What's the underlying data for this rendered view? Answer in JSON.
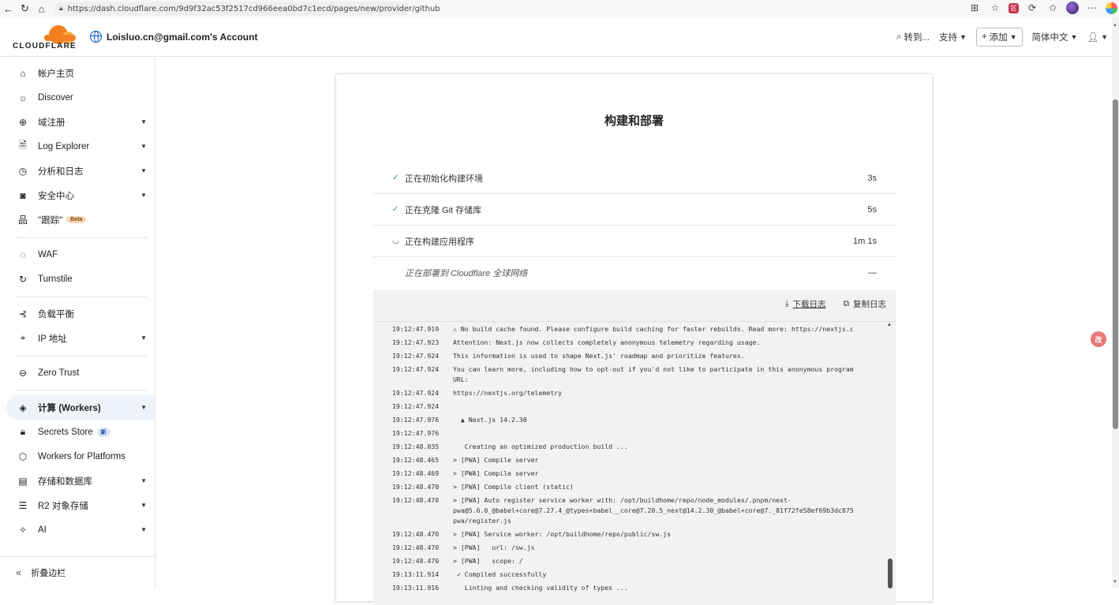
{
  "browser": {
    "url": "https://dash.cloudflare.com/9d9f32ac53f2517cd966eea0bd7c1ecd/pages/new/provider/github"
  },
  "header": {
    "logo_text": "CLOUDFLARE",
    "account": "Loisluo.cn@gmail.com's Account",
    "goto": "转到...",
    "support": "支持",
    "add": "添加",
    "language": "简体中文"
  },
  "sidebar": {
    "items": [
      {
        "label": "帐户主页",
        "icon": "home-icon"
      },
      {
        "label": "Discover",
        "icon": "lightbulb-icon"
      },
      {
        "label": "域注册",
        "icon": "globe-icon"
      },
      {
        "label": "Log Explorer",
        "icon": "file-search-icon"
      },
      {
        "label": "分析和日志",
        "icon": "clock-icon"
      },
      {
        "label": "安全中心",
        "icon": "shield-box-icon"
      },
      {
        "label": "\"跟踪\"",
        "icon": "network-icon",
        "badge": "Beta"
      },
      {
        "label": "WAF",
        "icon": "waf-icon"
      },
      {
        "label": "Turnstile",
        "icon": "turnstile-icon"
      },
      {
        "label": "负载平衡",
        "icon": "load-balance-icon"
      },
      {
        "label": "IP 地址",
        "icon": "pin-icon"
      },
      {
        "label": "Zero Trust",
        "icon": "zero-trust-icon"
      },
      {
        "label": "计算 (Workers)",
        "icon": "workers-icon"
      },
      {
        "label": "Secrets Store",
        "icon": "lock-icon",
        "badge": "新"
      },
      {
        "label": "Workers for Platforms",
        "icon": "box-icon"
      },
      {
        "label": "存储和数据库",
        "icon": "database-icon"
      },
      {
        "label": "R2 对象存储",
        "icon": "bucket-icon"
      },
      {
        "label": "AI",
        "icon": "sparkle-icon"
      }
    ],
    "collapse_label": "折叠边栏"
  },
  "card": {
    "title": "构建和部署",
    "steps": [
      {
        "label": "正在初始化构建环境",
        "duration": "3s",
        "status": "done"
      },
      {
        "label": "正在克隆 Git 存储库",
        "duration": "5s",
        "status": "done"
      },
      {
        "label": "正在构建应用程序",
        "duration": "1m 1s",
        "status": "running"
      },
      {
        "label": "正在部署到 Cloudflare 全球网络",
        "duration": "—",
        "status": "pending"
      }
    ],
    "download_log": "下载日志",
    "copy_log": "复制日志"
  },
  "log": [
    {
      "ts": "19:12:47.919",
      "msg": "⚠ No build cache found. Please configure build caching for faster rebuilds. Read more: https://nextjs.c"
    },
    {
      "ts": "19:12:47.923",
      "msg": "Attention: Next.js now collects completely anonymous telemetry regarding usage."
    },
    {
      "ts": "19:12:47.924",
      "msg": "This information is used to shape Next.js' roadmap and prioritize features."
    },
    {
      "ts": "19:12:47.924",
      "msg": "You can learn more, including how to opt-out if you'd not like to participate in this anonymous program\nURL:"
    },
    {
      "ts": "19:12:47.924",
      "msg": "https://nextjs.org/telemetry"
    },
    {
      "ts": "19:12:47.924",
      "msg": ""
    },
    {
      "ts": "19:12:47.976",
      "msg": "  ▲ Next.js 14.2.30"
    },
    {
      "ts": "19:12:47.976",
      "msg": ""
    },
    {
      "ts": "19:12:48.035",
      "msg": "   Creating an optimized production build ..."
    },
    {
      "ts": "19:12:48.465",
      "msg": "> [PWA] Compile server"
    },
    {
      "ts": "19:12:48.469",
      "msg": "> [PWA] Compile server"
    },
    {
      "ts": "19:12:48.470",
      "msg": "> [PWA] Compile client (static)"
    },
    {
      "ts": "19:12:48.470",
      "msg": "> [PWA] Auto register service worker with: /opt/buildhome/repo/node_modules/.pnpm/next-\npwa@5.6.0_@babel+core@7.27.4_@types+babel__core@7.20.5_next@14.2.30_@babel+core@7._81f72fe58ef69b3dc875\npwa/register.js"
    },
    {
      "ts": "19:12:48.470",
      "msg": "> [PWA] Service worker: /opt/buildhome/repo/public/sw.js"
    },
    {
      "ts": "19:12:48.470",
      "msg": "> [PWA]   url: /sw.js"
    },
    {
      "ts": "19:12:48.470",
      "msg": "> [PWA]   scope: /"
    },
    {
      "ts": "19:13:11.914",
      "msg": " ✓ Compiled successfully"
    },
    {
      "ts": "19:13:11.916",
      "msg": "   Linting and checking validity of types ..."
    }
  ],
  "floating_label": "改"
}
